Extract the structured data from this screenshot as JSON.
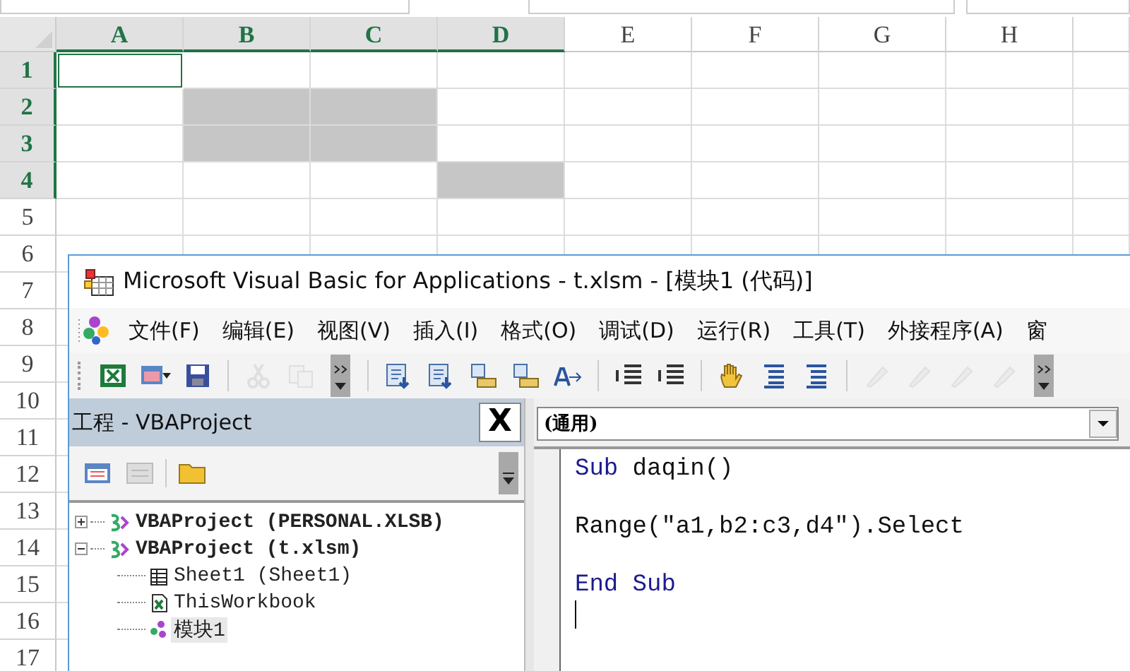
{
  "sheet": {
    "columns": [
      {
        "label": "A",
        "selected": true
      },
      {
        "label": "B",
        "selected": true
      },
      {
        "label": "C",
        "selected": true
      },
      {
        "label": "D",
        "selected": true
      },
      {
        "label": "E",
        "selected": false
      },
      {
        "label": "F",
        "selected": false
      },
      {
        "label": "G",
        "selected": false
      },
      {
        "label": "H",
        "selected": false
      }
    ],
    "rows": [
      {
        "label": "1",
        "selected": true,
        "cells": [
          {
            "selected": false,
            "active": true
          },
          {
            "selected": false,
            "active": false
          },
          {
            "selected": false,
            "active": false
          },
          {
            "selected": false,
            "active": false
          }
        ]
      },
      {
        "label": "2",
        "selected": true,
        "cells": [
          {
            "selected": false,
            "active": false
          },
          {
            "selected": true,
            "active": false
          },
          {
            "selected": true,
            "active": false
          },
          {
            "selected": false,
            "active": false
          }
        ]
      },
      {
        "label": "3",
        "selected": true,
        "cells": [
          {
            "selected": false,
            "active": false
          },
          {
            "selected": true,
            "active": false
          },
          {
            "selected": true,
            "active": false
          },
          {
            "selected": false,
            "active": false
          }
        ]
      },
      {
        "label": "4",
        "selected": true,
        "cells": [
          {
            "selected": false,
            "active": false
          },
          {
            "selected": false,
            "active": false
          },
          {
            "selected": false,
            "active": false
          },
          {
            "selected": true,
            "active": false
          }
        ]
      },
      {
        "label": "5",
        "selected": false
      },
      {
        "label": "6",
        "selected": false
      },
      {
        "label": "7",
        "selected": false
      },
      {
        "label": "8",
        "selected": false
      },
      {
        "label": "9",
        "selected": false
      },
      {
        "label": "10",
        "selected": false
      },
      {
        "label": "11",
        "selected": false
      },
      {
        "label": "12",
        "selected": false
      },
      {
        "label": "13",
        "selected": false
      },
      {
        "label": "14",
        "selected": false
      },
      {
        "label": "15",
        "selected": false
      },
      {
        "label": "16",
        "selected": false
      },
      {
        "label": "17",
        "selected": false
      }
    ]
  },
  "vbe": {
    "window": {
      "title": "Microsoft Visual Basic for Applications - t.xlsm - [模块1 (代码)]"
    },
    "menu": [
      "文件(F)",
      "编辑(E)",
      "视图(V)",
      "插入(I)",
      "格式(O)",
      "调试(D)",
      "运行(R)",
      "工具(T)",
      "外接程序(A)",
      "窗"
    ],
    "toolbar": [
      {
        "kind": "excel",
        "disabled": false
      },
      {
        "kind": "form",
        "disabled": false
      },
      {
        "kind": "save",
        "disabled": false
      },
      {
        "kind": "sep"
      },
      {
        "kind": "cut",
        "disabled": true
      },
      {
        "kind": "copy",
        "disabled": true
      },
      {
        "kind": "overflow"
      },
      {
        "kind": "sep"
      },
      {
        "kind": "list",
        "disabled": false
      },
      {
        "kind": "down",
        "disabled": false
      },
      {
        "kind": "info",
        "disabled": false
      },
      {
        "kind": "param",
        "disabled": false
      },
      {
        "kind": "word",
        "disabled": false
      },
      {
        "kind": "sep"
      },
      {
        "kind": "indent",
        "disabled": false
      },
      {
        "kind": "outdent",
        "disabled": false
      },
      {
        "kind": "sep"
      },
      {
        "kind": "hand",
        "disabled": false
      },
      {
        "kind": "lines",
        "disabled": false
      },
      {
        "kind": "unlines",
        "disabled": false
      },
      {
        "kind": "sep"
      },
      {
        "kind": "pen",
        "disabled": true
      },
      {
        "kind": "pen",
        "disabled": true
      },
      {
        "kind": "pen",
        "disabled": true
      },
      {
        "kind": "pen",
        "disabled": true
      },
      {
        "kind": "overflow"
      }
    ],
    "project": {
      "title": "工程 - VBAProject",
      "close": "X",
      "tree": [
        {
          "label": "VBAProject (PERSONAL.XLSB)",
          "kind": "project",
          "expanded": false,
          "selected": false
        },
        {
          "label": "VBAProject (t.xlsm)",
          "kind": "project",
          "expanded": true,
          "selected": false,
          "children": [
            {
              "label": "Sheet1 (Sheet1)",
              "kind": "sheet",
              "selected": false
            },
            {
              "label": "ThisWorkbook",
              "kind": "workbook",
              "selected": false
            },
            {
              "label": "模块1",
              "kind": "module",
              "selected": true
            }
          ]
        }
      ]
    },
    "code": {
      "object_dropdown": "(通用)",
      "lines": [
        [
          {
            "text": "Sub",
            "kind": "keyword"
          },
          {
            "text": " daqin()",
            "kind": "plain"
          }
        ],
        [
          {
            "text": "Range(\"a1,b2:c3,d4\").Select",
            "kind": "plain"
          }
        ],
        [
          {
            "text": "End Sub",
            "kind": "keyword"
          }
        ]
      ]
    }
  }
}
